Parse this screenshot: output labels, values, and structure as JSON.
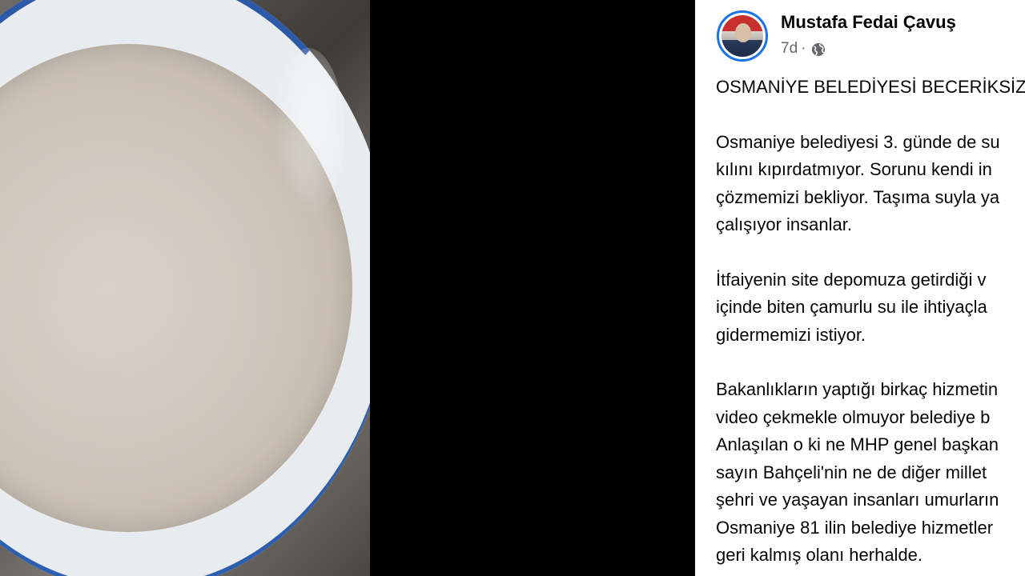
{
  "post": {
    "author": "Mustafa Fedai Çavuş",
    "timestamp": "7d",
    "separator": "·",
    "privacy_icon": "globe-icon",
    "paragraphs": [
      [
        "OSMANİYE BELEDİYESİ BECERİKSİZ"
      ],
      [
        "Osmaniye belediyesi 3. günde de su",
        "kılını kıpırdatmıyor. Sorunu kendi in",
        "çözmemizi bekliyor. Taşıma suyla ya",
        "çalışıyor insanlar."
      ],
      [
        "İtfaiyenin site depomuza getirdiği v",
        "içinde biten çamurlu su ile ihtiyaçla",
        "gidermemizi istiyor."
      ],
      [
        "Bakanlıkların yaptığı birkaç hizmetin",
        "video çekmekle olmuyor belediye b",
        "Anlaşılan o ki ne MHP genel başkan",
        "sayın Bahçeli'nin ne de diğer millet",
        "şehri ve yaşayan insanları umurların",
        "Osmaniye 81 ilin belediye hizmetler",
        "geri kalmış olanı herhalde."
      ]
    ]
  },
  "colors": {
    "avatar_ring": "#1b74e4",
    "author_text": "#050505",
    "meta_text": "#65676b",
    "background": "#000000"
  }
}
